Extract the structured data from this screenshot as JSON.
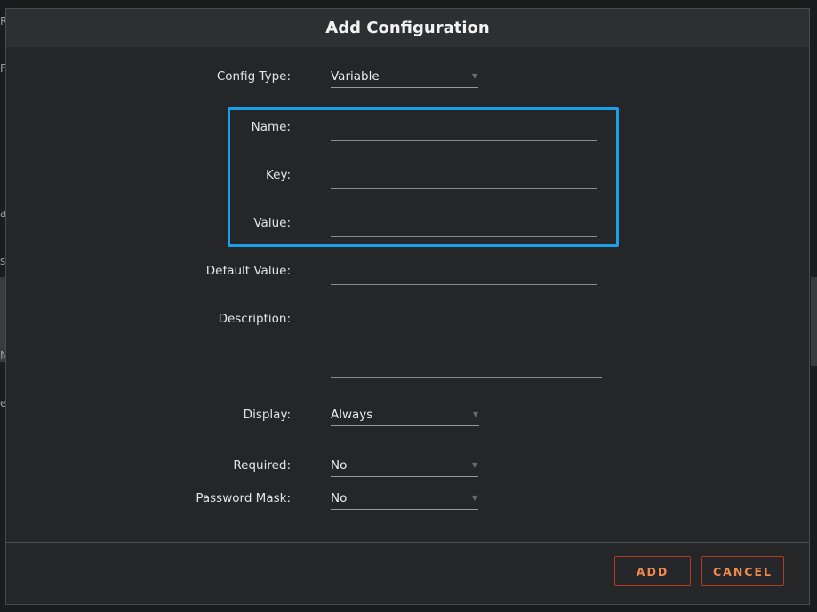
{
  "background": {
    "glyphs": [
      "R",
      "F",
      "a",
      "s",
      "N",
      "e"
    ]
  },
  "dialog": {
    "title": "Add Configuration"
  },
  "form": {
    "config_type": {
      "label": "Config Type:",
      "value": "Variable"
    },
    "name": {
      "label": "Name:",
      "value": ""
    },
    "key": {
      "label": "Key:",
      "value": ""
    },
    "value": {
      "label": "Value:",
      "value": ""
    },
    "default_value": {
      "label": "Default Value:",
      "value": ""
    },
    "description": {
      "label": "Description:",
      "value": ""
    },
    "display": {
      "label": "Display:",
      "value": "Always"
    },
    "required": {
      "label": "Required:",
      "value": "No"
    },
    "password_mask": {
      "label": "Password Mask:",
      "value": "No"
    }
  },
  "buttons": {
    "add": "ADD",
    "cancel": "CANCEL"
  },
  "colors": {
    "highlight": "#1aa0e8",
    "button_text": "#f08a4b",
    "button_border": "#b23a24"
  },
  "icons": {
    "dropdown": "caret-down-icon"
  }
}
